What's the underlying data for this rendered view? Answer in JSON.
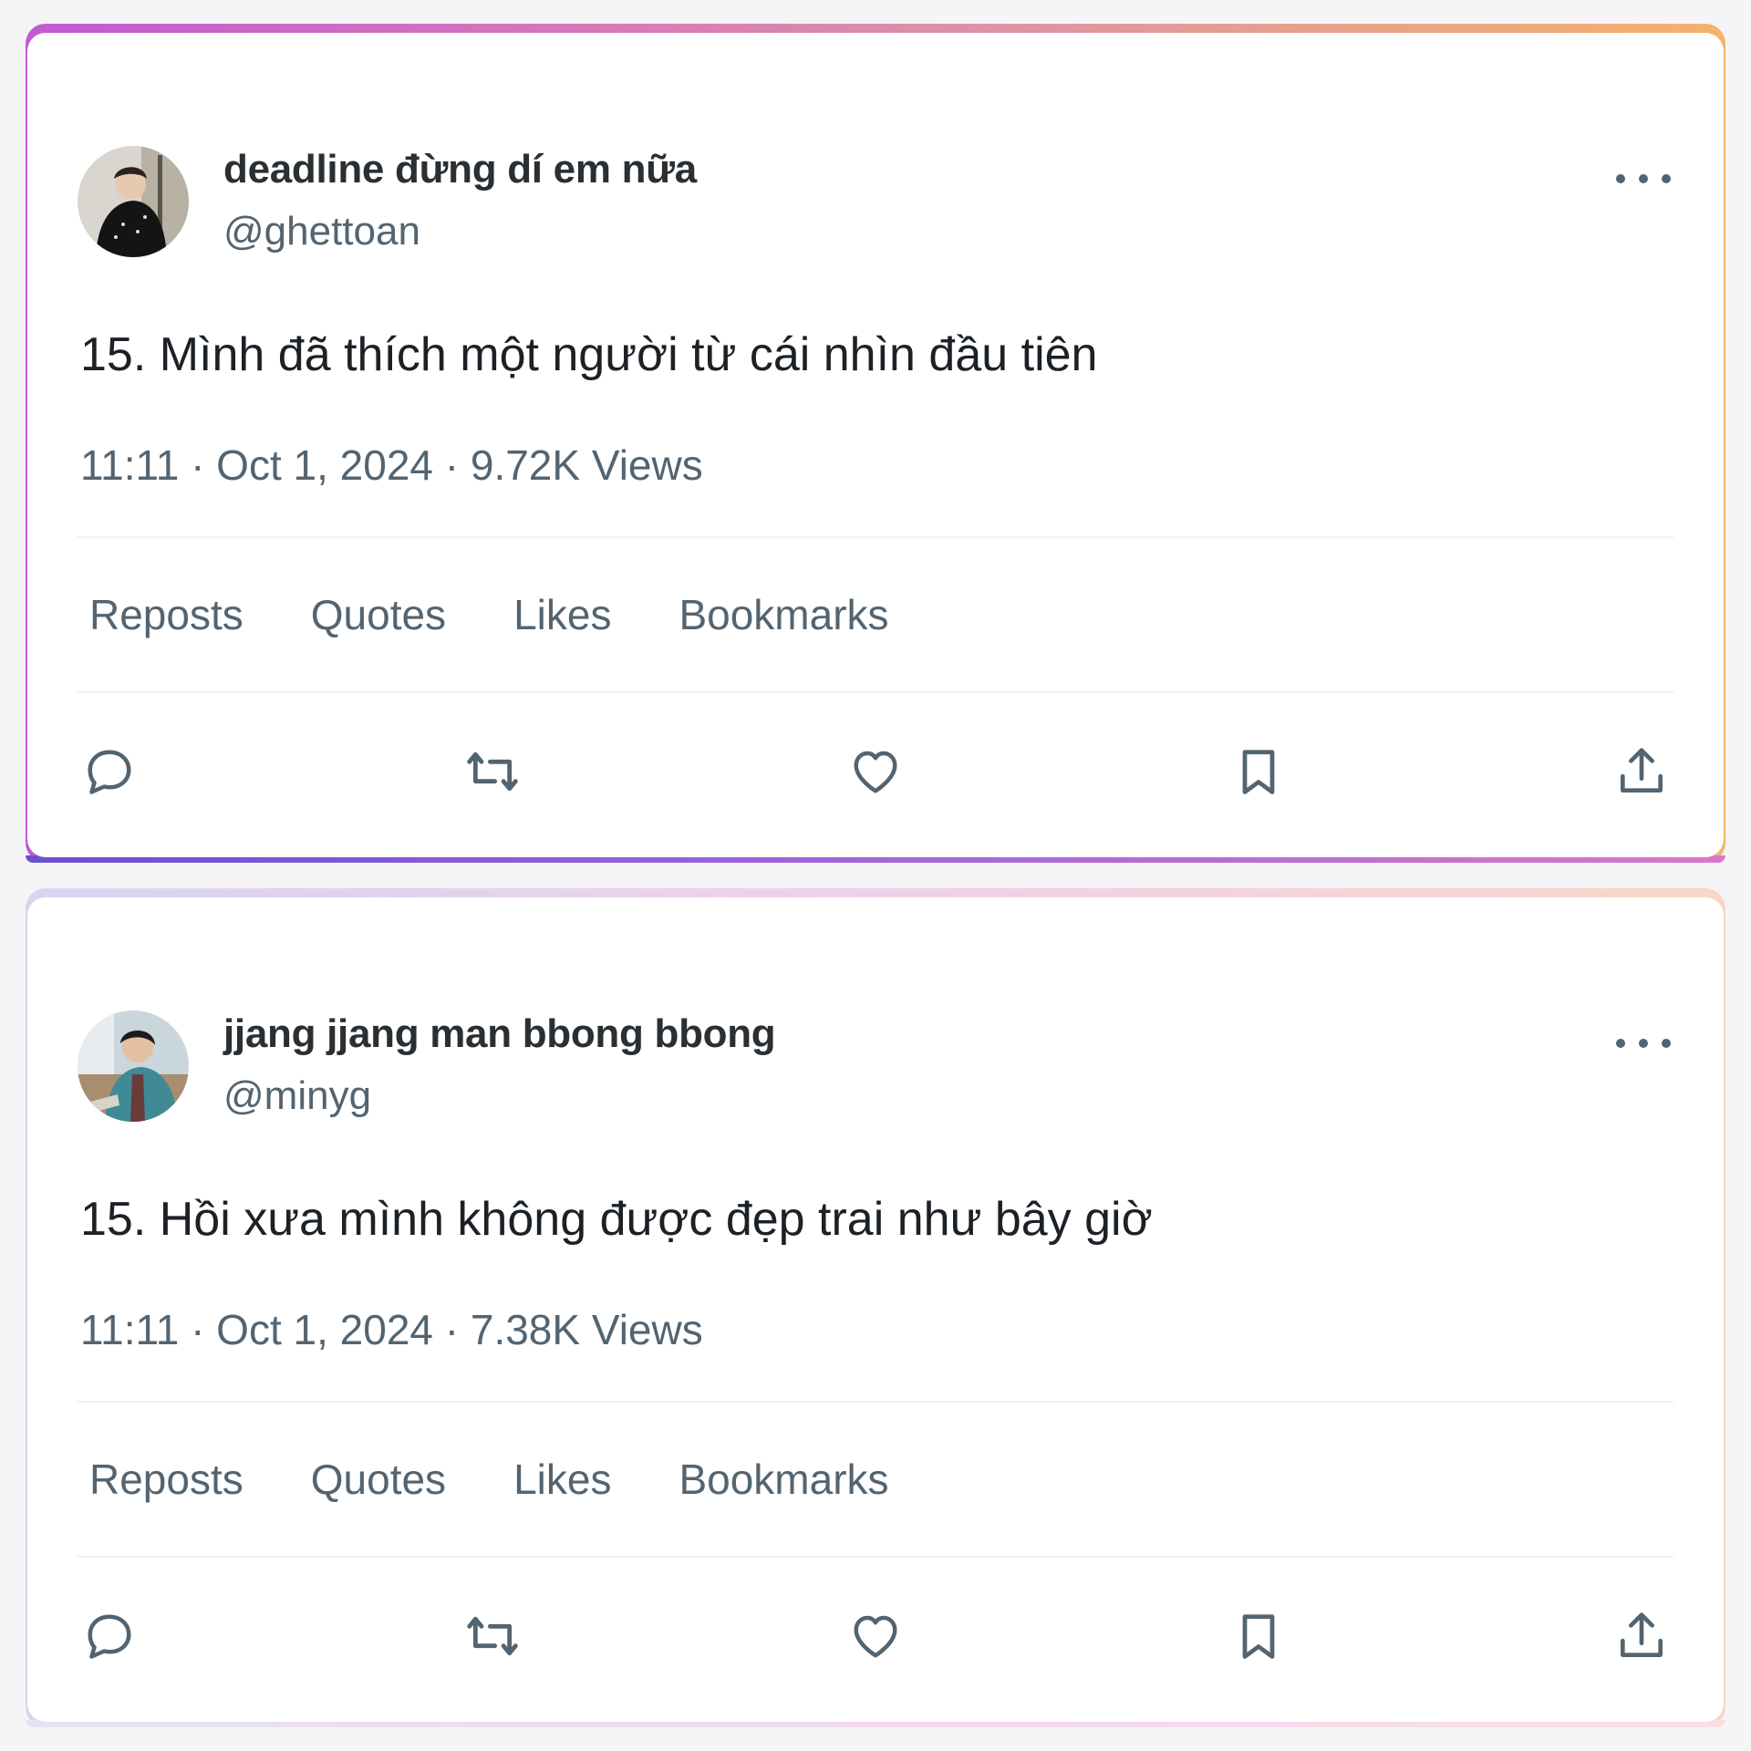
{
  "tweets": [
    {
      "display_name": "deadline đừng dí em nữa",
      "handle": "@ghettoan",
      "text": "15. Mình đã thích một người từ cái nhìn đầu tiên",
      "meta": "11:11 · Oct 1, 2024 · 9.72K Views",
      "stats": [
        "Reposts",
        "Quotes",
        "Likes",
        "Bookmarks"
      ],
      "avatar_icon": "profile-photo-dark-outfit"
    },
    {
      "display_name": "jjang jjang man bbong bbong",
      "handle": "@minyg",
      "text": "15. Hồi xưa mình không được đẹp trai như bây giờ",
      "meta": "11:11 · Oct 1, 2024 · 7.38K Views",
      "stats": [
        "Reposts",
        "Quotes",
        "Likes",
        "Bookmarks"
      ],
      "avatar_icon": "profile-photo-teal-jacket"
    }
  ],
  "actions": [
    "reply-icon",
    "repost-icon",
    "like-icon",
    "bookmark-icon",
    "share-icon"
  ],
  "colors": {
    "text_primary": "#1b2126",
    "text_secondary": "#536471",
    "icon": "#536471",
    "frame_1_top": [
      "#c25ad2",
      "#e08fa8",
      "#f5b26b"
    ],
    "frame_2_top": [
      "#d8d4f0",
      "#efd0ea",
      "#f8d6c8"
    ]
  }
}
